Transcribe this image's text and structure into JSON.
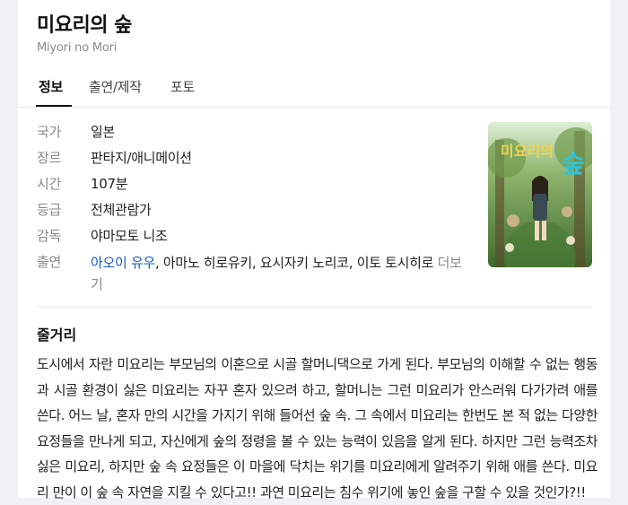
{
  "movie": {
    "title": "미요리의 숲",
    "original_title": "Miyori no Mori"
  },
  "tabs": [
    {
      "label": "정보",
      "active": true
    },
    {
      "label": "출연/제작",
      "active": false
    },
    {
      "label": "포토",
      "active": false
    }
  ],
  "info": {
    "country": {
      "label": "국가",
      "value": "일본"
    },
    "genre": {
      "label": "장르",
      "value": "판타지/애니메이션"
    },
    "runtime": {
      "label": "시간",
      "value": "107분"
    },
    "rating": {
      "label": "등급",
      "value": "전체관람가"
    },
    "director": {
      "label": "감독",
      "value": "야마모토 니조"
    },
    "cast": {
      "label": "출연",
      "first": "아오이 유우",
      "rest": ", 아마노 히로유키, 요시자키 노리코, 이토 토시히로",
      "more": "더보기"
    }
  },
  "poster": {
    "title_text": "미요리의 숲",
    "colors": {
      "forest": "#4f7a3a",
      "sky": "#d9ead0",
      "title": "#2ec4d6"
    }
  },
  "synopsis": {
    "heading": "줄거리",
    "text": "도시에서 자란 미요리는 부모님의 이혼으로 시골 할머니댁으로 가게 된다. 부모님의 이해할 수 없는 행동과 시골 환경이 싫은 미요리는 자꾸 혼자 있으려 하고, 할머니는 그런 미요리가 안스러워 다가가려 애를 쓴다. 어느 날, 혼자 만의 시간을 가지기 위해 들어선 숲 속. 그 속에서 미요리는 한번도 본 적 없는 다양한 요정들을 만나게 되고, 자신에게 숲의 정령을 볼 수 있는 능력이 있음을 알게 된다. 하지만 그런 능력조차 싫은 미요리, 하지만 숲 속 요정들은 이 마을에 닥치는 위기를 미요리에게 알려주기 위해 애를 쓴다. 미요리 만이 이 숲 속 자연을 지킬 수 있다고!! 과연 미요리는 침수 위기에 놓인 숲을 구할 수 있을 것인가?!!"
  }
}
